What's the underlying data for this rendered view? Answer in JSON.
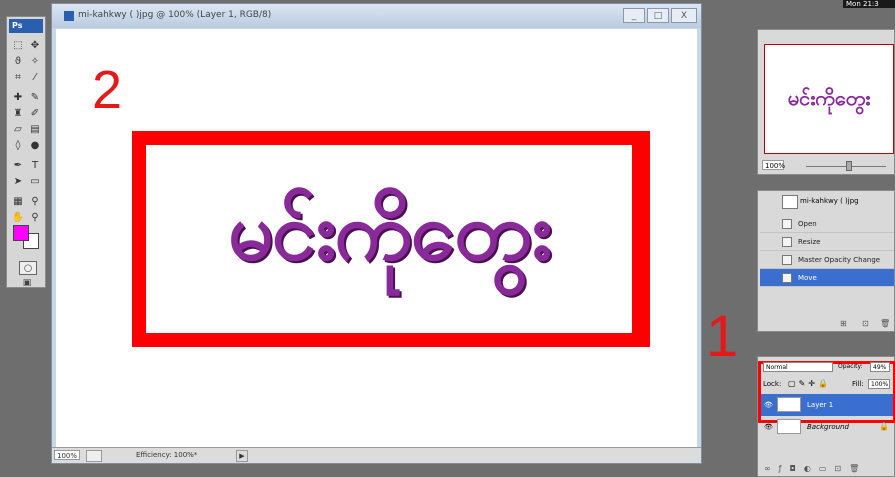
{
  "tools": {
    "badge": "Ps",
    "icons": [
      "marquee-icon",
      "move-icon",
      "lasso-icon",
      "magic-wand-icon",
      "crop-icon",
      "slice-icon",
      "healing-icon",
      "brush-icon",
      "stamp-icon",
      "history-brush-icon",
      "eraser-icon",
      "gradient-icon",
      "blur-icon",
      "dodge-icon",
      "pen-icon",
      "type-icon",
      "path-select-icon",
      "shape-icon",
      "notes-icon",
      "eyedropper-icon",
      "hand-icon",
      "zoom-icon"
    ],
    "foreground_color": "#ff00ff",
    "background_color": "#ffffff"
  },
  "document": {
    "title": "mi-kahkwy (  )jpg @ 100% (Layer 1, RGB/8)",
    "canvas_text": "မင်းကိုတွေး",
    "zoom": "100%",
    "efficiency": "Efficiency: 100%*",
    "minimize": "_",
    "maximize": "□",
    "close": "X"
  },
  "annotations": {
    "step1": "1",
    "step2": "2"
  },
  "menubar": {
    "clock": "Mon 21:3"
  },
  "navigator": {
    "preview_text": "မင်းကိုတွေး",
    "zoom": "100%"
  },
  "history": {
    "snapshot_label": "mi-kahkwy (  )jpg",
    "items": [
      "Open",
      "Resize",
      "Master Opacity Change",
      "Move"
    ],
    "selected": "Move"
  },
  "layers": {
    "blend_mode": "Normal",
    "opacity_label": "Opacity:",
    "opacity": "49%",
    "lock_label": "Lock:",
    "fill_label": "Fill:",
    "fill": "100%",
    "rows": [
      {
        "name": "Layer 1",
        "selected": true
      },
      {
        "name": "Background",
        "selected": false
      }
    ]
  },
  "colors": {
    "highlight_red": "#ff0000",
    "selection_blue": "#3a6fd0",
    "text_purple": "#8a2a9a"
  }
}
